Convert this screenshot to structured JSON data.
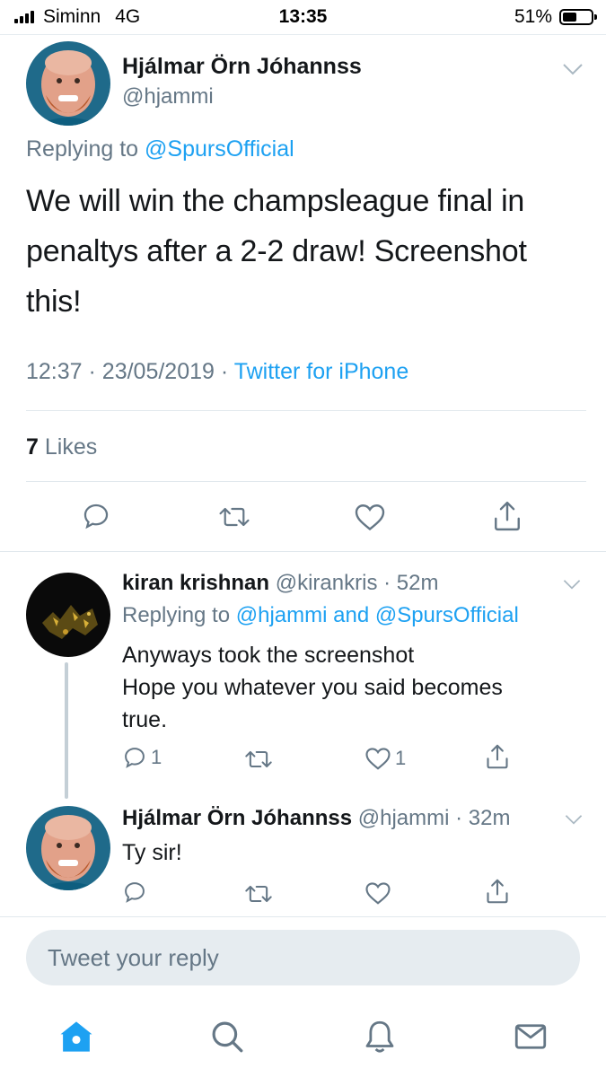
{
  "status_bar": {
    "carrier": "Siminn",
    "network": "4G",
    "time": "13:35",
    "battery_percent": "51%",
    "battery_level": 0.51
  },
  "main_tweet": {
    "author_name": "Hjálmar Örn Jóhannss",
    "author_handle": "@hjammi",
    "replying_prefix": "Replying to",
    "replying_to": "@SpursOfficial",
    "text_lines": [
      "We will win the champsleague final in",
      "penaltys after a 2-2 draw! Screenshot",
      "this!"
    ],
    "time": "12:37",
    "date": "23/05/2019",
    "separator": "·",
    "source": "Twitter for iPhone",
    "likes_count": "7",
    "likes_label": "Likes"
  },
  "reply_1": {
    "author_name": "kiran krishnan",
    "author_handle": "@kirankris",
    "age": "· 52m",
    "replying_prefix": "Replying to",
    "replying_to": "@hjammi and @SpursOfficial",
    "text_lines": [
      "Anyways took the screenshot",
      "Hope you whatever you said becomes",
      "true."
    ],
    "reply_count": "1",
    "like_count": "1"
  },
  "reply_2": {
    "author_name": "Hjálmar Örn Jóhannss",
    "author_handle": "@hjammi",
    "age": "· 32m",
    "text": "Ty sir!"
  },
  "compose": {
    "placeholder": "Tweet your reply"
  },
  "tab_bar": {
    "tabs": [
      "home-icon",
      "search-icon",
      "notifications-icon",
      "messages-icon"
    ],
    "active": "home-icon"
  },
  "colors": {
    "accent": "#1da1f2",
    "muted": "#657786",
    "text": "#14171a",
    "divider": "#e1e8ed",
    "compose_bg": "#e6ecf0"
  }
}
